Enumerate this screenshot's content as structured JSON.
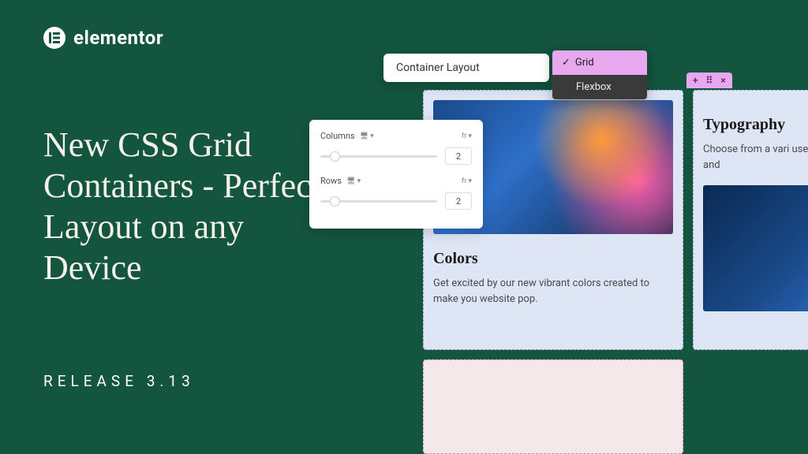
{
  "brand": {
    "name": "elementor"
  },
  "headline": "New CSS Grid Containers - Perfect Layout on any Device",
  "release": "RELEASE 3.13",
  "layout_popup": {
    "label": "Container Layout"
  },
  "dropdown": {
    "selected": "Grid",
    "options": [
      "Grid",
      "Flexbox"
    ]
  },
  "controls": {
    "columns": {
      "label": "Columns",
      "unit": "fr",
      "value": "2"
    },
    "rows": {
      "label": "Rows",
      "unit": "fr",
      "value": "2"
    }
  },
  "cards": {
    "colors": {
      "title": "Colors",
      "body": "Get excited by our new vibrant colors created to make you website pop."
    },
    "typography": {
      "title": "Typography",
      "body": "Choose from a vari user attention and"
    }
  },
  "handle": {
    "add": "+",
    "drag": "⠿",
    "close": "×"
  }
}
